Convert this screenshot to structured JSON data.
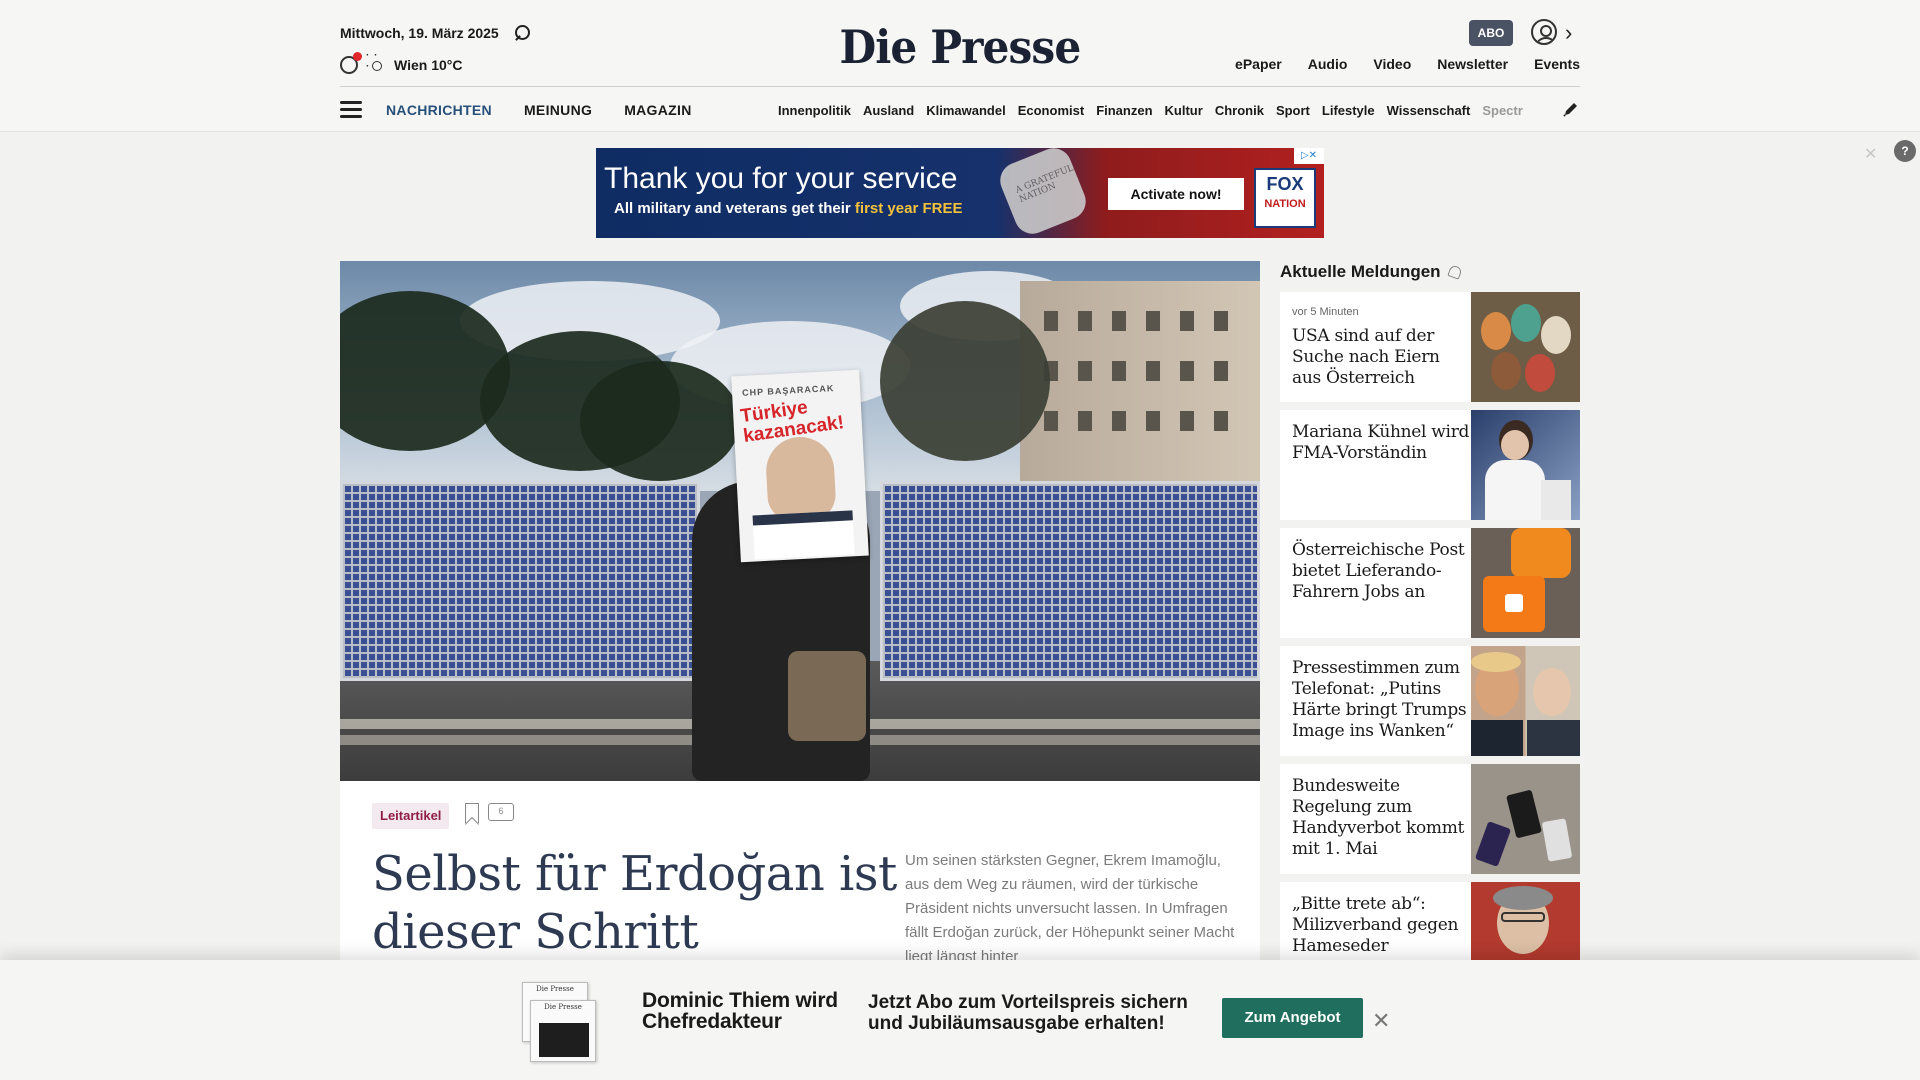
{
  "header": {
    "date": "Mittwoch, 19. März 2025",
    "weather": "Wien 10°C",
    "logo": "Die Presse",
    "abo_label": "ABO",
    "top_links": [
      "ePaper",
      "Audio",
      "Video",
      "Newsletter",
      "Events"
    ],
    "icons": [
      "search-icon",
      "clock-icon",
      "sun-icon",
      "user-icon",
      "chevron-right-icon",
      "menu-icon",
      "pencil-icon"
    ]
  },
  "nav": {
    "main": [
      "NACHRICHTEN",
      "MEINUNG",
      "MAGAZIN"
    ],
    "sub": [
      "Innenpolitik",
      "Ausland",
      "Klimawandel",
      "Economist",
      "Finanzen",
      "Kultur",
      "Chronik",
      "Sport",
      "Lifestyle",
      "Wissenschaft",
      "Spectr"
    ]
  },
  "ad": {
    "headline": "Thank you for your service",
    "subline_prefix": "All military and veterans get their ",
    "subline_highlight": "first year FREE",
    "cta": "Activate now!",
    "brand_top": "FOX",
    "brand_bottom": "NATION",
    "tag_text": "A GRATEFUL NATION"
  },
  "hero": {
    "poster_top": "CHP BAŞARACAK",
    "poster_main": "Türkiye kazanacak!"
  },
  "article": {
    "kicker": "Leitartikel",
    "comments": "6",
    "title": "Selbst für Erdoğan ist dieser Schritt beispiellos",
    "teaser": "Um seinen stärksten Gegner, Ekrem Imamoğlu, aus dem Weg zu räumen, wird der türkische Präsident nichts unversucht lassen. In Umfragen fällt Erdoğan zurück, der Höhepunkt seiner Macht liegt längst hinter"
  },
  "sidebar": {
    "title": "Aktuelle Meldungen",
    "items": [
      {
        "time": "vor 5 Minuten",
        "title": "USA sind auf der Suche nach Eiern aus Österreich"
      },
      {
        "time": "",
        "title": "Mariana Kühnel wird FMA-Vorständin"
      },
      {
        "time": "",
        "title": "Österreichische Post bietet Lieferando-Fahrern Jobs an"
      },
      {
        "time": "",
        "title": "Pressestimmen zum Telefonat: „Putins Härte bringt Trumps Image ins Wanken“"
      },
      {
        "time": "",
        "title": "Bundesweite Regelung zum Handyverbot kommt mit 1. Mai"
      },
      {
        "time": "",
        "title": "„Bitte trete ab“: Milizverband gegen Hameseder"
      }
    ]
  },
  "banner": {
    "headline": "Dominic Thiem wird Chefredakteur",
    "message": "Jetzt Abo zum Vorteilspreis sichern und Jubiläumsausgabe erhalten!",
    "cta": "Zum Angebot",
    "paper_label": "Die Presse"
  }
}
